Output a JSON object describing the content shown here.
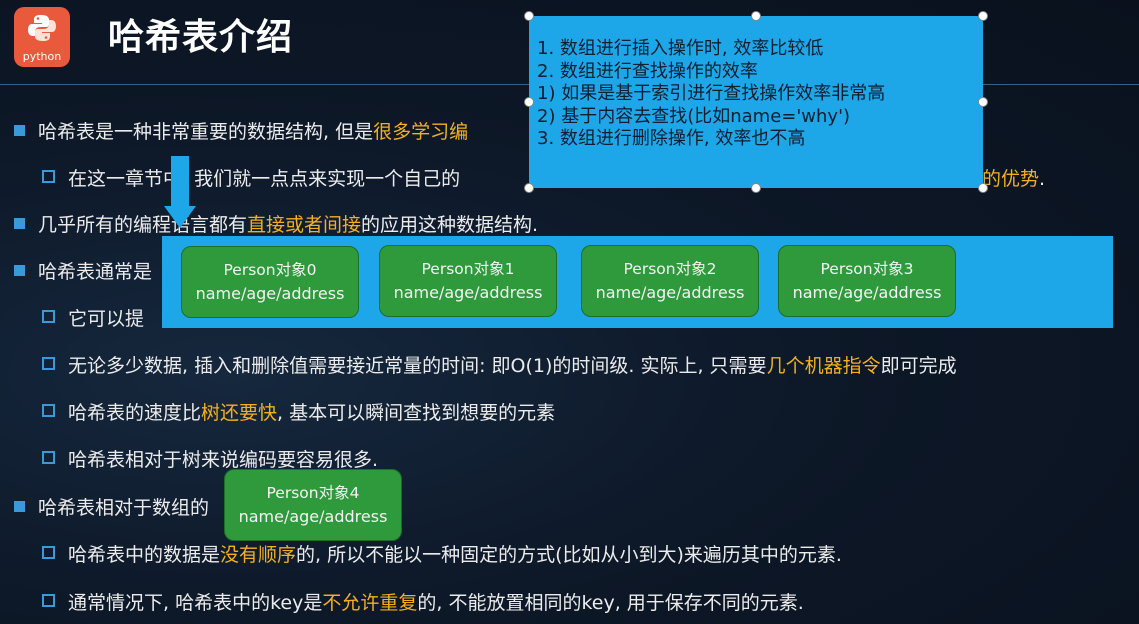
{
  "logo_text": "python",
  "title": "哈希表介绍",
  "lines": {
    "b1_a": "哈希表是一种非常重要的数据结构, 但是",
    "b1_hl": "很多学习编",
    "b1a_a": "在这一章节中, 我们就一点点来实现一个自己的",
    "b1a_hl": "的优势",
    "b1a_end": ".",
    "b2_a": "几乎所有的编程语言都有",
    "b2_hl": "直接或者间接",
    "b2_b": "的应用这种数据结构.",
    "b3_a": "哈希表通常是",
    "b3a_a": "它可以提",
    "b3b_a": "无论多少数据, 插入和删除值需要接近常量的时间: 即O(1)的时间级. 实际上, 只需要",
    "b3b_hl": "几个机器指令",
    "b3b_b": "即可完成",
    "b3c_a": "哈希表的速度比",
    "b3c_hl": "树还要快",
    "b3c_b": ", 基本可以瞬间查找到想要的元素",
    "b3d_a": "哈希表相对于树来说编码要容易很多.",
    "b4_a": "哈希表相对于数组的",
    "b4a_a": "哈希表中的数据是",
    "b4a_hl": "没有顺序",
    "b4a_b": "的, 所以不能以一种固定的方式(比如从小到大)来遍历其中的元素.",
    "b4b_a": "通常情况下, 哈希表中的key是",
    "b4b_hl": "不允许重复",
    "b4b_b": "的, 不能放置相同的key, 用于保存不同的元素."
  },
  "note": [
    "1. 数组进行插入操作时, 效率比较低",
    "2. 数组进行查找操作的效率",
    "1)    如果是基于索引进行查找操作效率非常高",
    "2)    基于内容去查找(比如name='why')",
    "3. 数组进行删除操作, 效率也不高"
  ],
  "boxes": [
    {
      "title": "Person对象0",
      "sub": "name/age/address"
    },
    {
      "title": "Person对象1",
      "sub": "name/age/address"
    },
    {
      "title": "Person对象2",
      "sub": "name/age/address"
    },
    {
      "title": "Person对象3",
      "sub": "name/age/address"
    },
    {
      "title": "Person对象4",
      "sub": "name/age/address"
    }
  ],
  "colors": {
    "accent": "#1da6e8",
    "highlight": "#f5b021",
    "box": "#2e9a3c"
  }
}
